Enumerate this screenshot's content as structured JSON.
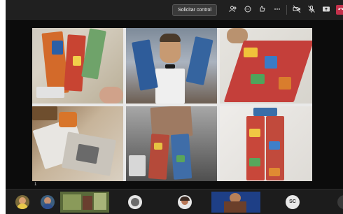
{
  "toolbar": {
    "request_control_label": "Solicitar control",
    "icons": [
      "participants-icon",
      "chat-icon",
      "reactions-icon",
      "more-icon",
      "camera-off-icon",
      "mic-off-icon",
      "share-icon",
      "leave-icon"
    ]
  },
  "share": {
    "page_number": "1"
  },
  "participants": {
    "initials": "SC"
  },
  "colors": {
    "background": "#1f1f1f",
    "stage": "#0c0c0c",
    "leave": "#c4314b",
    "request_button": "#3a3a3a"
  }
}
